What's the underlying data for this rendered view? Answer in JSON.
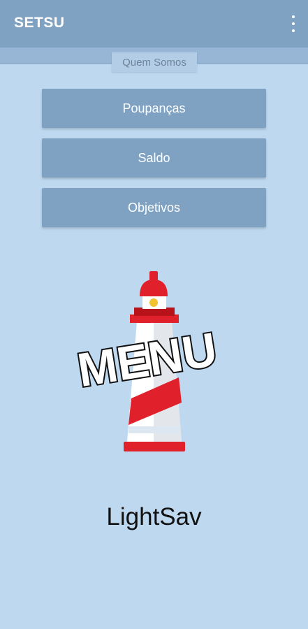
{
  "appbar": {
    "title": "SETSU",
    "overflow_icon": "more-vert-icon"
  },
  "tab": {
    "label": "Quem Somos"
  },
  "menu": {
    "buttons": [
      {
        "label": "Poupanças"
      },
      {
        "label": "Saldo"
      },
      {
        "label": "Objetivos"
      }
    ]
  },
  "logo": {
    "text": "MENU",
    "icon": "lighthouse-icon"
  },
  "app_name": "LightSav",
  "colors": {
    "background": "#bed8ef",
    "appbar": "#7fa1c2",
    "button": "#7fa1c2",
    "lighthouse_red": "#e0202a"
  }
}
